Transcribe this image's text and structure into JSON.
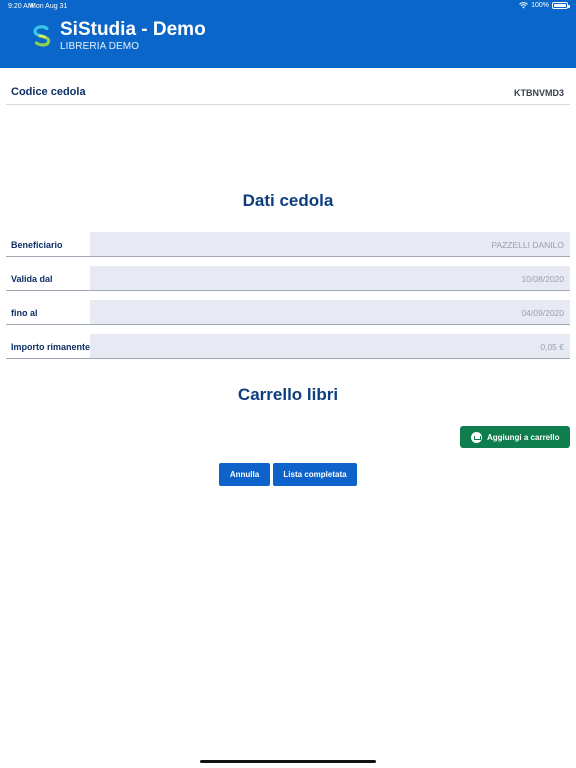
{
  "status_bar": {
    "time": "9:20 AM",
    "date": "Mon Aug 31",
    "battery_text": "100%",
    "icons": [
      "wifi-icon",
      "battery-icon"
    ]
  },
  "header": {
    "title": "SiStudia - Demo",
    "subtitle": "LIBRERIA DEMO",
    "logo_icon": "sistudia-logo-icon",
    "background_color": "#0a66c8"
  },
  "codice": {
    "label": "Codice cedola",
    "value": "KTBNVMD3"
  },
  "dati_cedola": {
    "title": "Dati cedola",
    "rows": [
      {
        "label": "Beneficiario",
        "value": "PAZZELLI DANILO"
      },
      {
        "label": "Valida dal",
        "value": "10/08/2020"
      },
      {
        "label": "fino al",
        "value": "04/09/2020"
      },
      {
        "label": "Importo rimanente",
        "value": "0,05 €"
      }
    ]
  },
  "carrello": {
    "title": "Carrello libri",
    "add_button_label": "Aggiungi a carrello",
    "add_button_icon": "cart-icon",
    "add_button_color": "#0f7d4e"
  },
  "actions": {
    "cancel_label": "Annulla",
    "complete_label": "Lista completata",
    "button_color": "#0d63c9"
  }
}
